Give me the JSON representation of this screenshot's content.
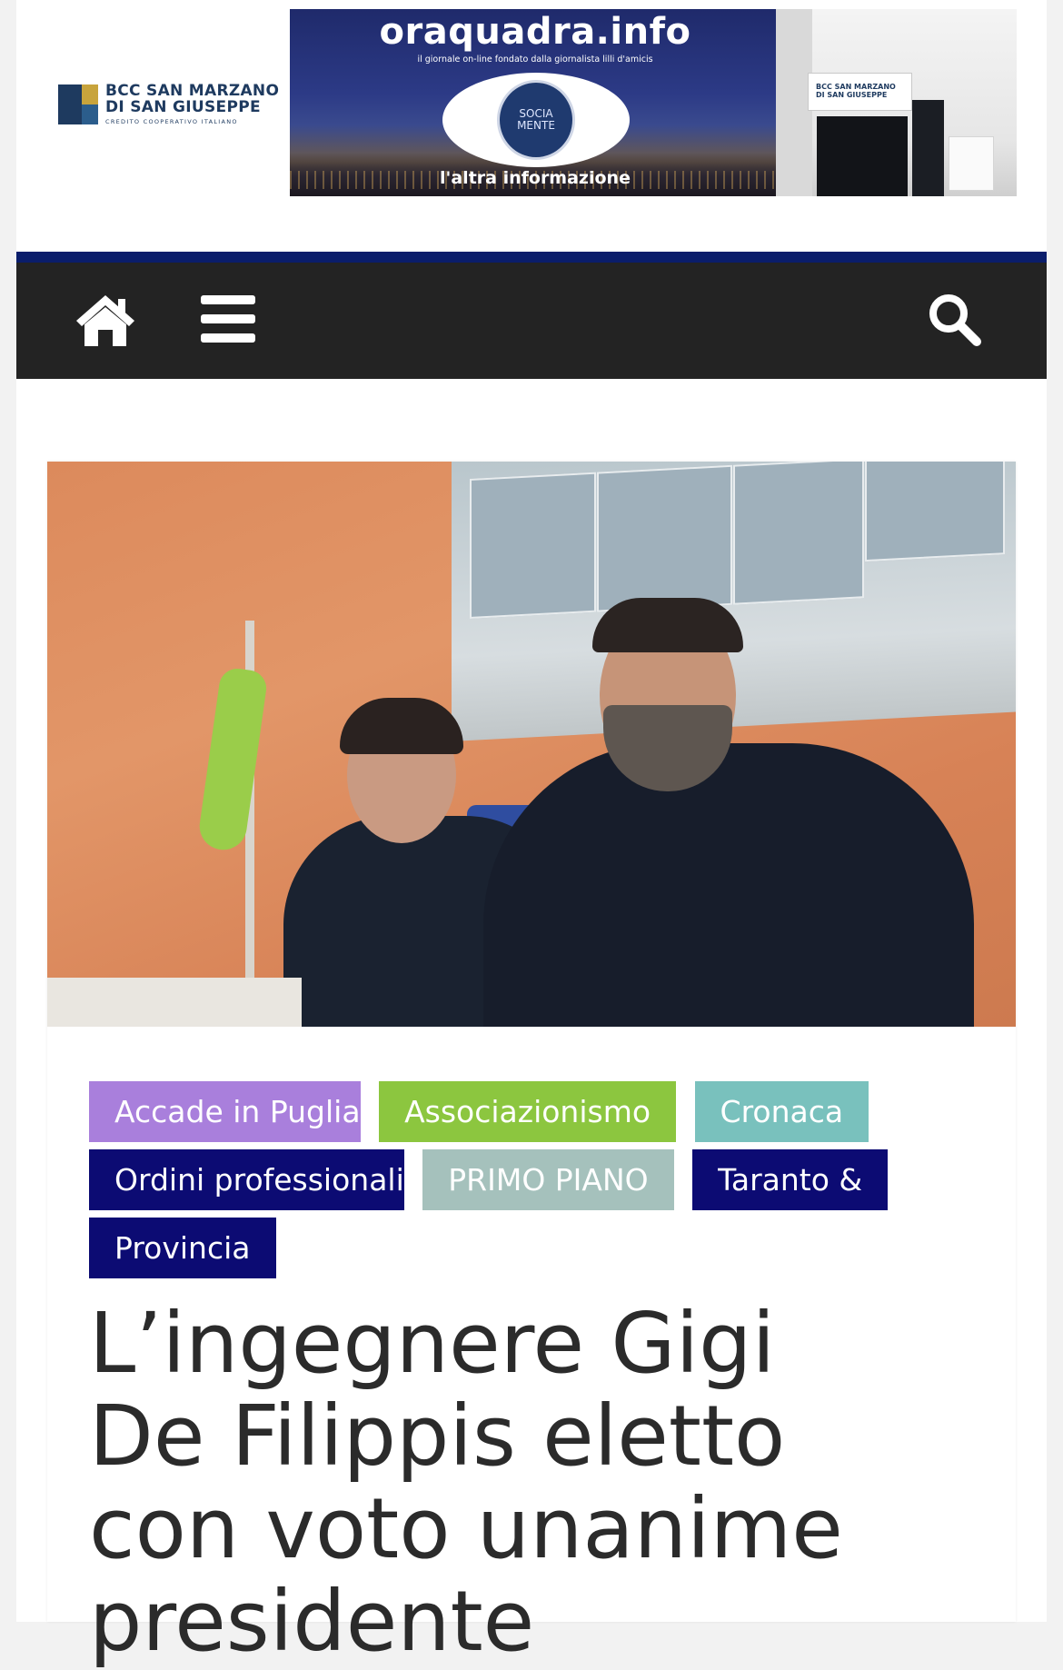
{
  "header": {
    "logo": {
      "line1": "BCC SAN MARZANO",
      "line2": "DI SAN GIUSEPPE",
      "line3": "CREDITO COOPERATIVO ITALIANO"
    },
    "banner": {
      "title": "oraquadra.info",
      "subtitle": "il giornale on-line fondato dalla giornalista lilli d'amicis",
      "eye_text_1": "SOCIA",
      "eye_text_2": "MENTE",
      "tagline": "l'altra informazione",
      "photo_sign_1": "BCC SAN MARZANO",
      "photo_sign_2": "DI SAN GIUSEPPE"
    }
  },
  "nav": {
    "home_icon": "home-icon",
    "menu_icon": "hamburger-menu-icon",
    "search_icon": "search-icon",
    "bar_color": "#232323",
    "accent_color": "#0a1d6b"
  },
  "article": {
    "categories": [
      {
        "label": "Accade in Puglia",
        "color": "#a97fdc"
      },
      {
        "label": "Associazionismo",
        "color": "#8cc63f"
      },
      {
        "label": "Cronaca",
        "color": "#79c1bd"
      },
      {
        "label": "Ordini professionali",
        "color": "#0c0b73"
      },
      {
        "label": "PRIMO PIANO",
        "color": "#a5c1bc"
      },
      {
        "label": "Taranto & Provincia",
        "color": "#0c0b73"
      }
    ],
    "title": "L’ingegnere Gigi De Filippis eletto con voto unanime presidente"
  }
}
